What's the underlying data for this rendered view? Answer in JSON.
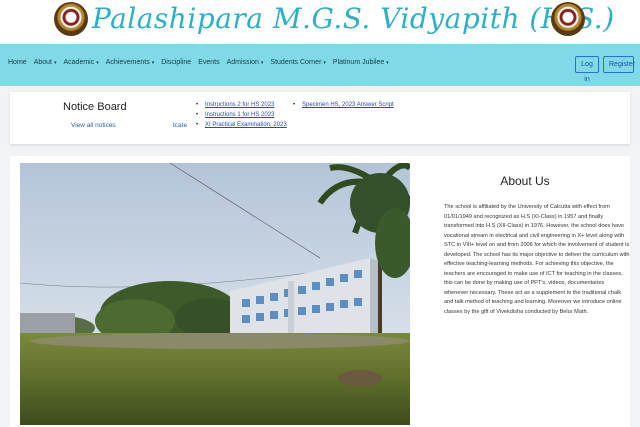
{
  "header": {
    "title": "Palashipara M.G.S. Vidyapith (H.S.)"
  },
  "navbar": {
    "items": [
      {
        "label": "Home",
        "dropdown": false
      },
      {
        "label": "About",
        "dropdown": true
      },
      {
        "label": "Academic",
        "dropdown": true
      },
      {
        "label": "Achievements",
        "dropdown": true
      },
      {
        "label": "Discipline",
        "dropdown": false
      },
      {
        "label": "Events",
        "dropdown": false
      },
      {
        "label": "Admission",
        "dropdown": true
      },
      {
        "label": "Students Corner",
        "dropdown": true
      },
      {
        "label": "Platinum Jubilee",
        "dropdown": true
      }
    ],
    "caret": "▾",
    "login_label": "Log in",
    "register_label": "Register"
  },
  "notice": {
    "heading": "Notice Board",
    "view_all": "View all notices",
    "fragment": "tcate",
    "list1": [
      "Instructions 2 for HS 2023",
      "Instructions 1 for HS 2023",
      "XI Practical Examination, 2023"
    ],
    "list2": [
      "Specimen HS, 2023 Answer Script"
    ]
  },
  "about": {
    "title": "About Us",
    "body": "The school is affiliated by the University of Calcutta with effect from 01/01/1949 and recognized as H.S (XI-Class) in 1957 and finally transformed into H.S (XII-Class) in 1976. However, the school does have vocational stream in electrical and civil engineering in X+ level along with STC in VIII+ level on and from 2006 for which the involvement of student is developed. The school has its major objective to deliver the curriculum with effective teaching-learning methods. For achieving this objective, the teachers are encouraged to make use of ICT for teaching in the classes, this can be done by making use of PPT's, videos, documentaries whenever necessary. These act as a supplement to the traditional chalk and talk method of teaching and learning. Moreover we introduce online classes by the gift of Vivekdisha conducted by Belur Math."
  },
  "colors": {
    "title": "#2bb0c8",
    "navbar": "#7fd9e6",
    "link": "#1f4fb0"
  }
}
